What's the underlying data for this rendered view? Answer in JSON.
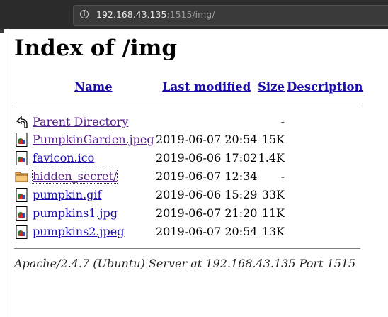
{
  "browser": {
    "url_host": "192.168.43.135",
    "url_rest": ":1515/img/"
  },
  "page": {
    "title": "Index of /img",
    "columns": {
      "name": "Name",
      "modified": "Last modified",
      "size": "Size",
      "description": "Description"
    },
    "rows": [
      {
        "icon": "back-icon",
        "name": "Parent Directory",
        "modified": "",
        "size": "-",
        "visited": true
      },
      {
        "icon": "image-icon",
        "name": "PumpkinGarden.jpeg",
        "modified": "2019-06-07 20:54",
        "size": "15K",
        "visited": true
      },
      {
        "icon": "image-icon",
        "name": "favicon.ico",
        "modified": "2019-06-06 17:02",
        "size": "1.4K",
        "visited": false
      },
      {
        "icon": "folder-icon",
        "name": "hidden_secret/",
        "modified": "2019-06-07 12:34",
        "size": "-",
        "visited": true
      },
      {
        "icon": "image-icon",
        "name": "pumpkin.gif",
        "modified": "2019-06-06 15:29",
        "size": "33K",
        "visited": false
      },
      {
        "icon": "image-icon",
        "name": "pumpkins1.jpg",
        "modified": "2019-06-07 21:20",
        "size": "11K",
        "visited": false
      },
      {
        "icon": "image-icon",
        "name": "pumpkins2.jpeg",
        "modified": "2019-06-07 20:54",
        "size": "13K",
        "visited": false
      }
    ],
    "footer": "Apache/2.4.7 (Ubuntu) Server at 192.168.43.135 Port 1515"
  },
  "colors": {
    "link": "#1a0dab",
    "visited": "#551a8b",
    "chrome": "#2b2b2b"
  }
}
